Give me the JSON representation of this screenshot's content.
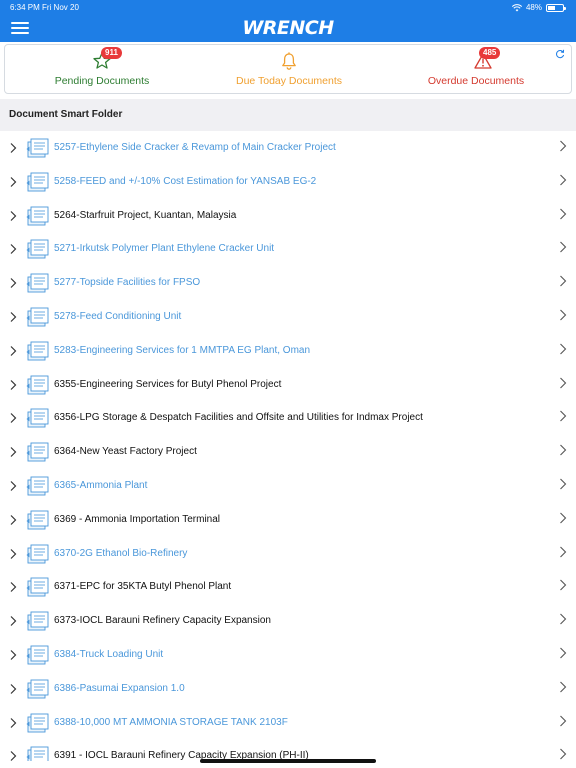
{
  "status": {
    "time": "6:34 PM",
    "date": "Fri Nov 20",
    "battery": "48%",
    "battery_level": 0.48
  },
  "header": {
    "brand": "WRENCH",
    "menu_icon": "hamburger-menu-icon"
  },
  "summary": {
    "items": [
      {
        "label": "Pending Documents",
        "count": "911",
        "icon": "star-icon",
        "color": "#2e7d32"
      },
      {
        "label": "Due Today Documents",
        "count": "",
        "icon": "bell-icon",
        "color": "#f0a030"
      },
      {
        "label": "Overdue Documents",
        "count": "485",
        "icon": "alert-triangle-icon",
        "color": "#d43a2f"
      }
    ],
    "refresh_icon": "refresh-icon"
  },
  "section": {
    "title": "Document Smart Folder"
  },
  "colors": {
    "accent": "#1e7ee6",
    "link_blue": "#4a97da",
    "badge_red": "#e8393a"
  },
  "documents": [
    {
      "title": "5257-Ethylene Side Cracker & Revamp of Main Cracker Project",
      "style": "blue"
    },
    {
      "title": "5258-FEED and +/-10% Cost Estimation for YANSAB EG-2",
      "style": "blue"
    },
    {
      "title": "5264-Starfruit Project, Kuantan, Malaysia",
      "style": "black"
    },
    {
      "title": "5271-Irkutsk Polymer Plant Ethylene Cracker Unit",
      "style": "blue"
    },
    {
      "title": "5277-Topside Facilities for FPSO",
      "style": "blue"
    },
    {
      "title": "5278-Feed Conditioning Unit",
      "style": "blue"
    },
    {
      "title": "5283-Engineering Services for 1 MMTPA EG Plant, Oman",
      "style": "blue"
    },
    {
      "title": "6355-Engineering Services for Butyl Phenol Project",
      "style": "black"
    },
    {
      "title": "6356-LPG Storage & Despatch Facilities and Offsite and Utilities for Indmax Project",
      "style": "black"
    },
    {
      "title": "6364-New Yeast Factory Project",
      "style": "black"
    },
    {
      "title": "6365-Ammonia Plant",
      "style": "blue"
    },
    {
      "title": "6369 - Ammonia Importation Terminal",
      "style": "black"
    },
    {
      "title": "6370-2G Ethanol Bio-Refinery",
      "style": "blue"
    },
    {
      "title": "6371-EPC for 35KTA Butyl Phenol Plant",
      "style": "black"
    },
    {
      "title": "6373-IOCL Barauni Refinery Capacity Expansion",
      "style": "black"
    },
    {
      "title": "6384-Truck Loading Unit",
      "style": "blue"
    },
    {
      "title": "6386-Pasumai Expansion 1.0",
      "style": "blue"
    },
    {
      "title": "6388-10,000 MT AMMONIA STORAGE TANK 2103F",
      "style": "blue"
    },
    {
      "title": "6391 - IOCL Barauni Refinery Capacity Expansion (PH-II)",
      "style": "black"
    }
  ]
}
